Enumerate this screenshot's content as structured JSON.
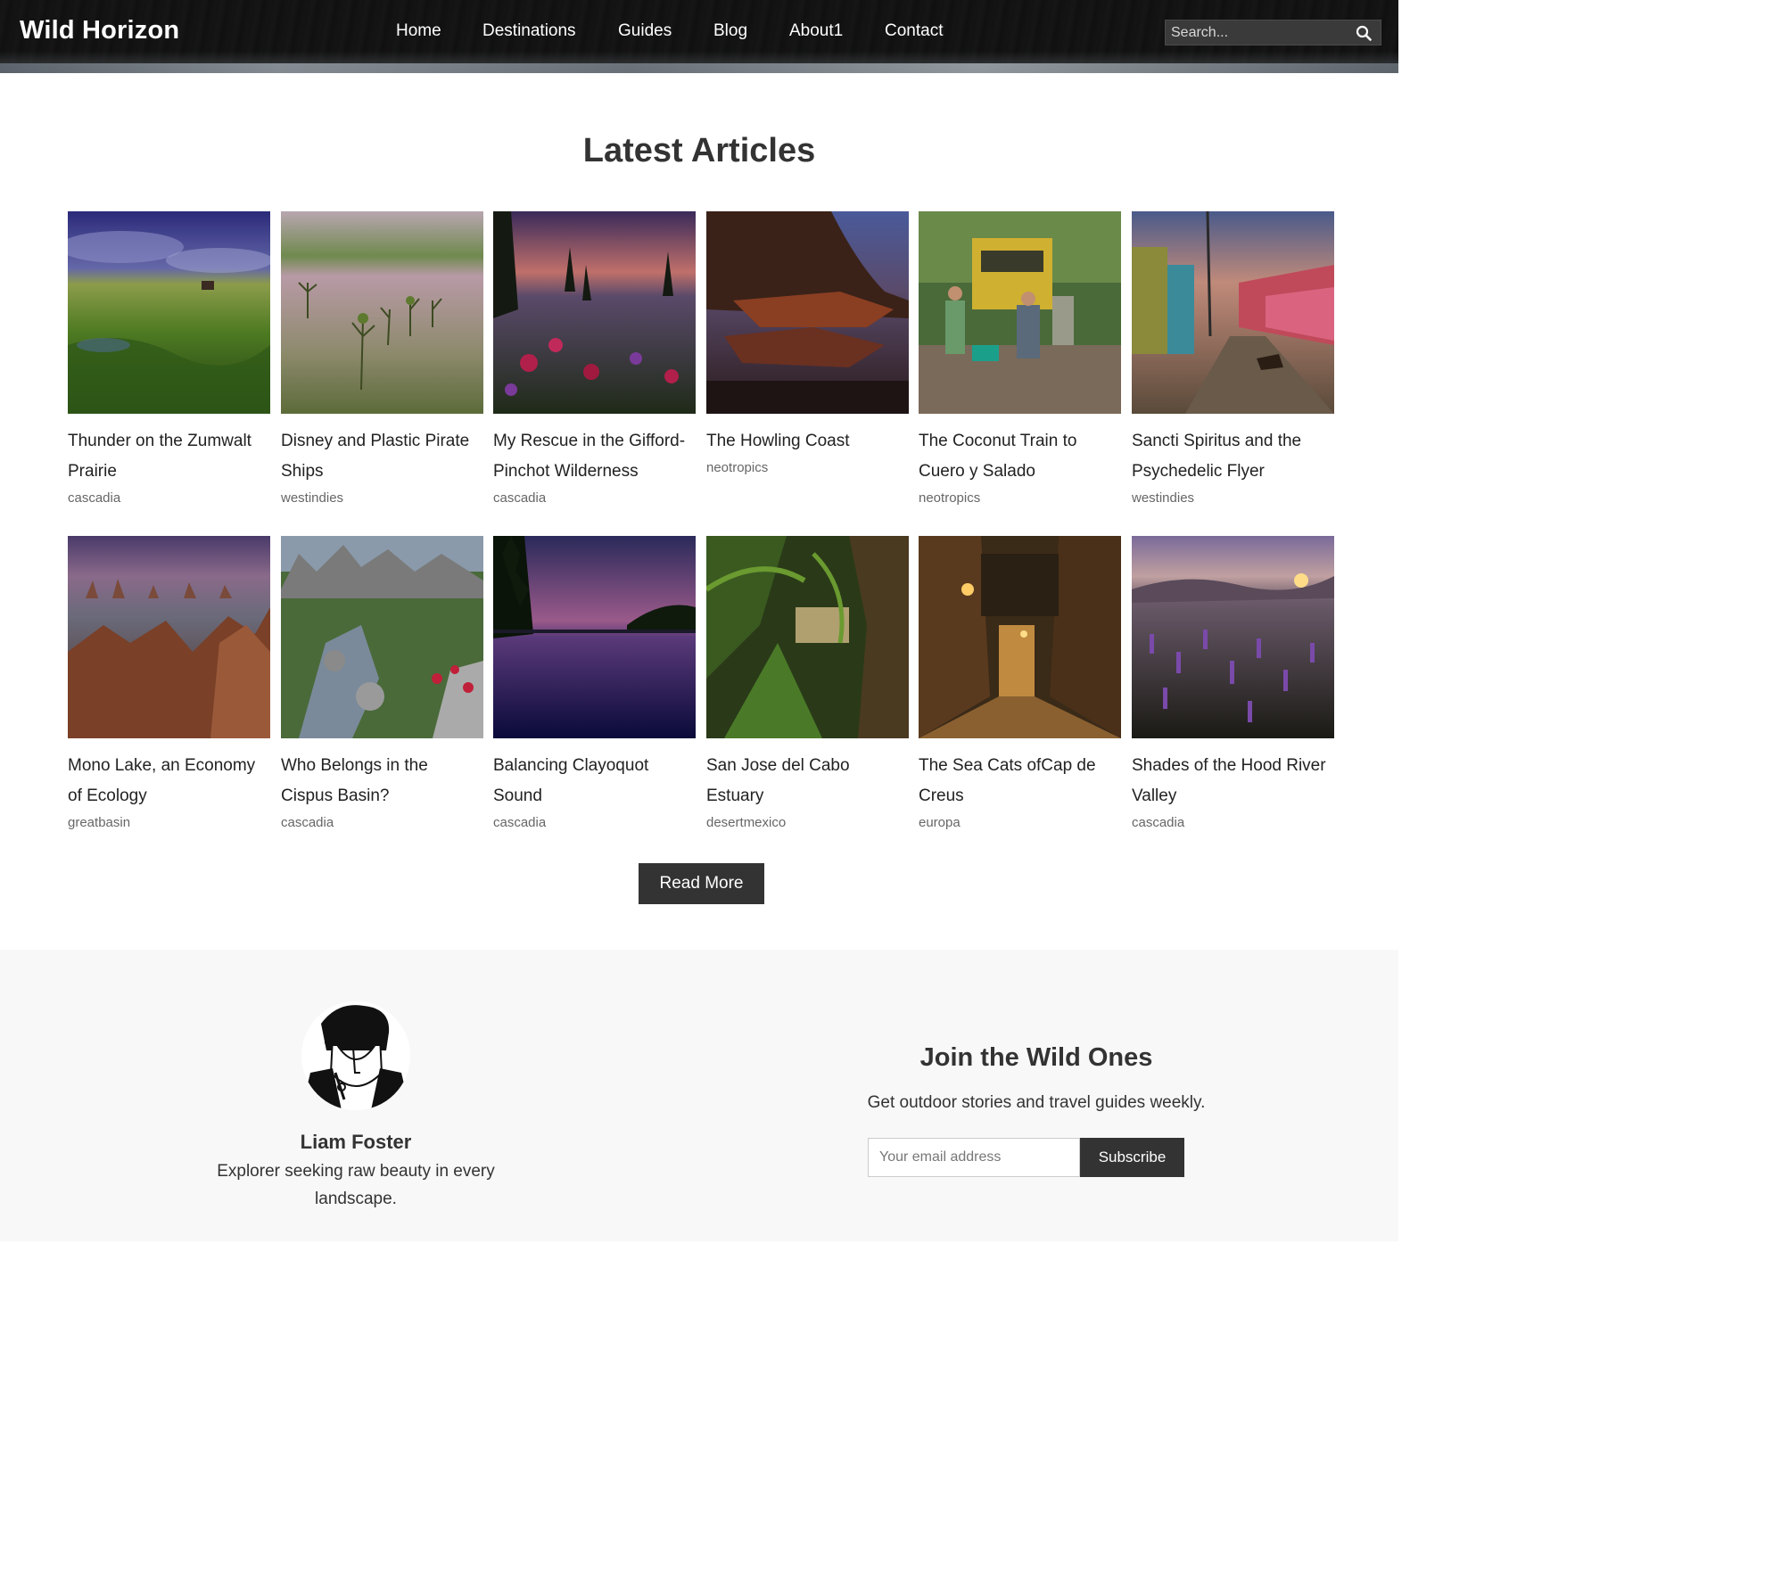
{
  "header": {
    "logo": "Wild Horizon",
    "nav": [
      "Home",
      "Destinations",
      "Guides",
      "Blog",
      "About1",
      "Contact"
    ],
    "search_placeholder": "Search..."
  },
  "main": {
    "section_title": "Latest Articles",
    "articles": [
      {
        "title": "Thunder on the Zumwalt Prairie",
        "tag": "cascadia",
        "image": "green prairie under stormy purple sky"
      },
      {
        "title": "Disney and Plastic Pirate Ships",
        "tag": "westindies",
        "image": "mangrove shoots in shallow pink water"
      },
      {
        "title": "My Rescue in the Gifford-Pinchot Wilderness",
        "tag": "cascadia",
        "image": "red wildflowers below mountain at sunset"
      },
      {
        "title": "The Howling Coast",
        "tag": "neotropics",
        "image": "rocky coastline with forest at dusk"
      },
      {
        "title": "The Coconut Train to Cuero y Salado",
        "tag": "neotropics",
        "image": "people walking to yellow train"
      },
      {
        "title": "Sancti Spiritus and the Psychedelic Flyer",
        "tag": "westindies",
        "image": "colorful village street with dog"
      },
      {
        "title": "Mono Lake, an Economy of Ecology",
        "tag": "greatbasin",
        "image": "tufa towers under purple sky"
      },
      {
        "title": "Who Belongs in the Cispus Basin?",
        "tag": "cascadia",
        "image": "alpine creek with red flowers"
      },
      {
        "title": "Balancing Clayoquot Sound",
        "tag": "cascadia",
        "image": "calm water reflecting purple sky"
      },
      {
        "title": "San Jose del Cabo Estuary",
        "tag": "desertmexico",
        "image": "palm fronds in tropical estuary"
      },
      {
        "title": "The Sea Cats ofCap de Creus",
        "tag": "europa",
        "image": "narrow stone alley with lamps at night"
      },
      {
        "title": "Shades of the Hood River Valley",
        "tag": "cascadia",
        "image": "purple lupine meadow at sunrise"
      }
    ],
    "read_more": "Read More"
  },
  "footer": {
    "author_name": "Liam Foster",
    "author_bio": "Explorer seeking raw beauty in every landscape.",
    "newsletter_title": "Join the Wild Ones",
    "newsletter_sub": "Get outdoor stories and travel guides weekly.",
    "email_placeholder": "Your email address",
    "subscribe_label": "Subscribe"
  },
  "colors": {
    "header_bg": "#1b1b1b",
    "button_bg": "#333333",
    "footer_bg": "#f8f8f8",
    "tag_text": "#666666"
  }
}
